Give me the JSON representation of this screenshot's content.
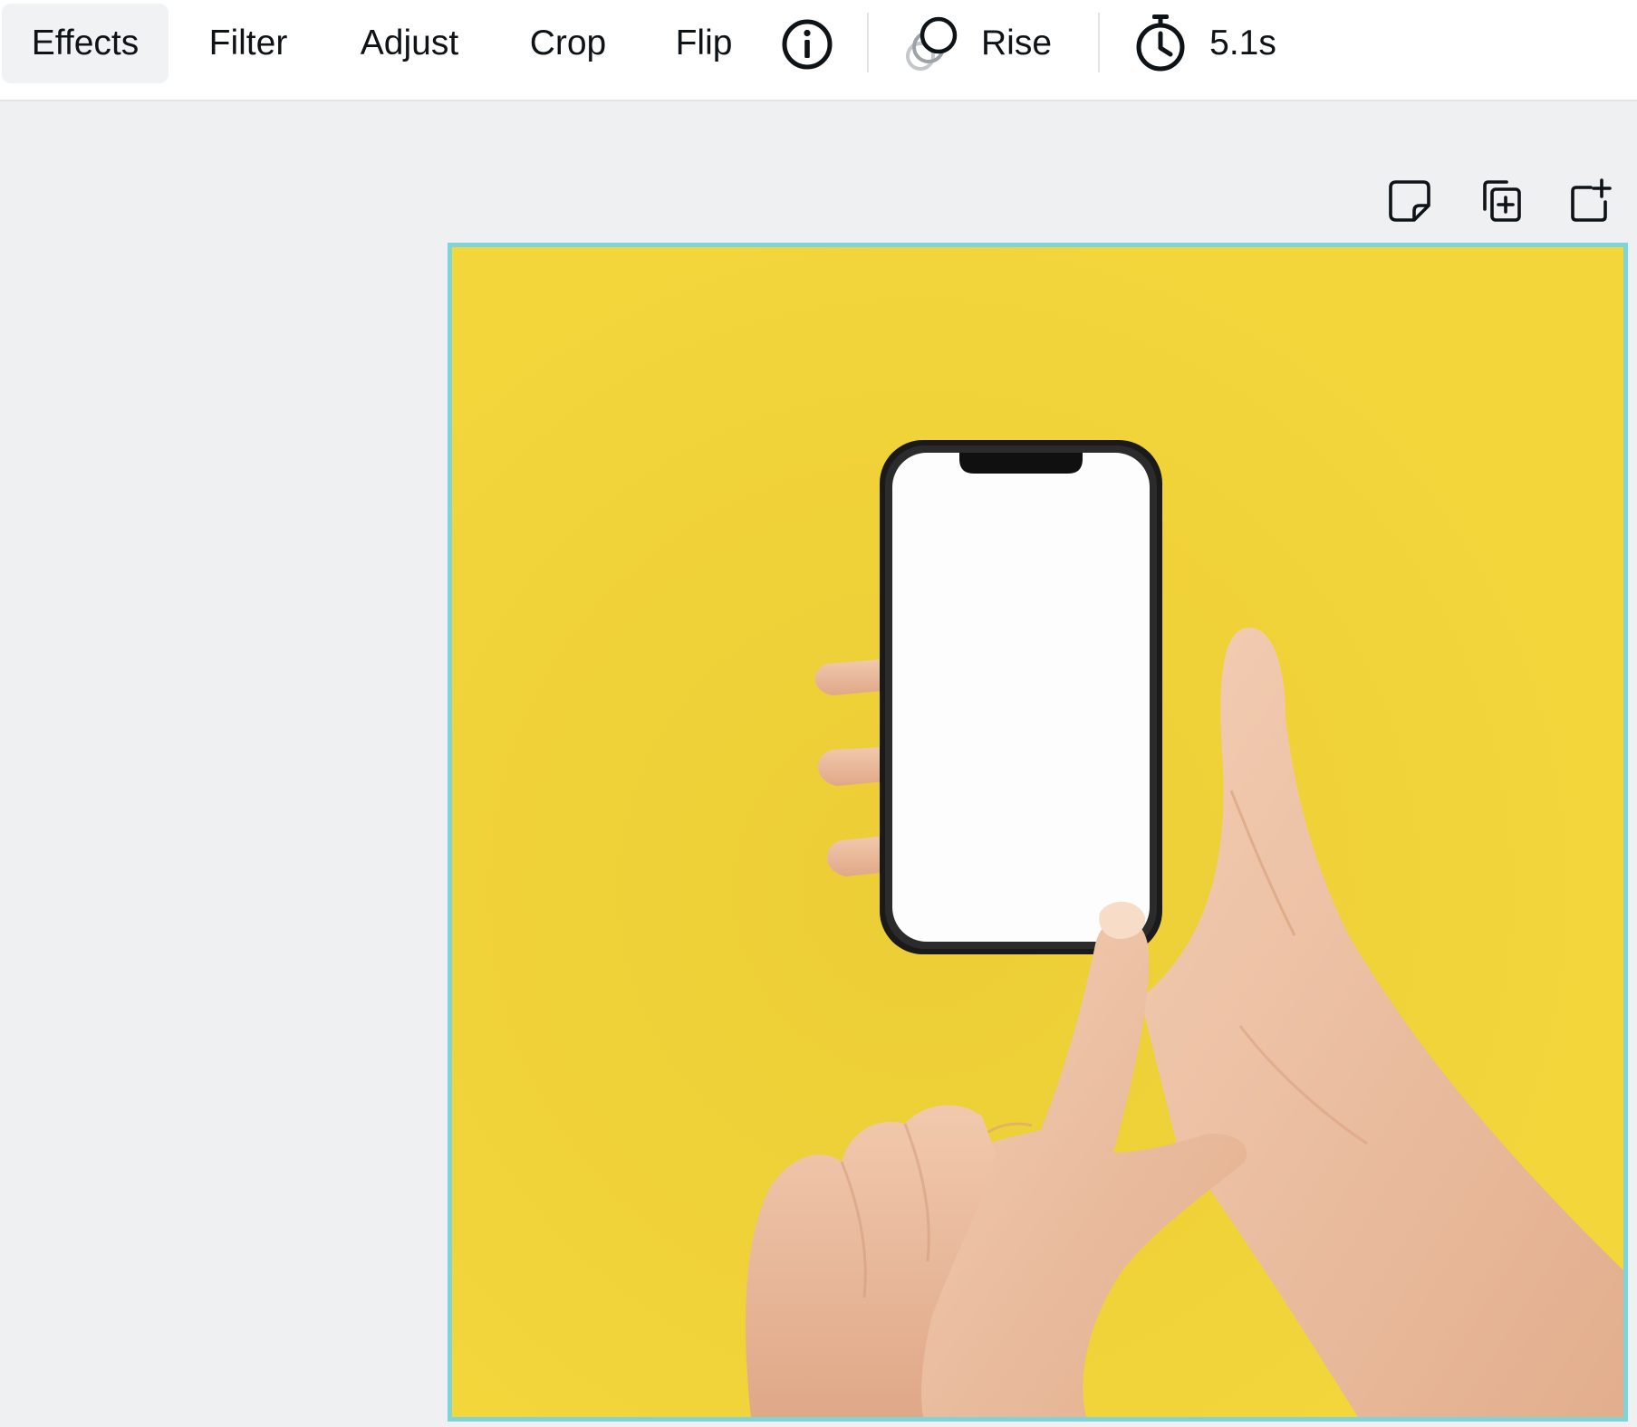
{
  "toolbar": {
    "effects_label": "Effects",
    "filter_label": "Filter",
    "adjust_label": "Adjust",
    "crop_label": "Crop",
    "flip_label": "Flip",
    "info_icon": "info-icon",
    "animation_icon": "animation-circles-icon",
    "animation_label": "Rise",
    "timer_icon": "stopwatch-icon",
    "duration_label": "5.1s"
  },
  "page_tools": {
    "note_icon": "sticky-note-icon",
    "duplicate_icon": "duplicate-page-icon",
    "add_page_icon": "add-page-icon"
  },
  "canvas": {
    "image_subject": "hands holding smartphone with blank screen on yellow background",
    "background_color": "#f2d63a",
    "selection_color": "#7fd3da"
  }
}
